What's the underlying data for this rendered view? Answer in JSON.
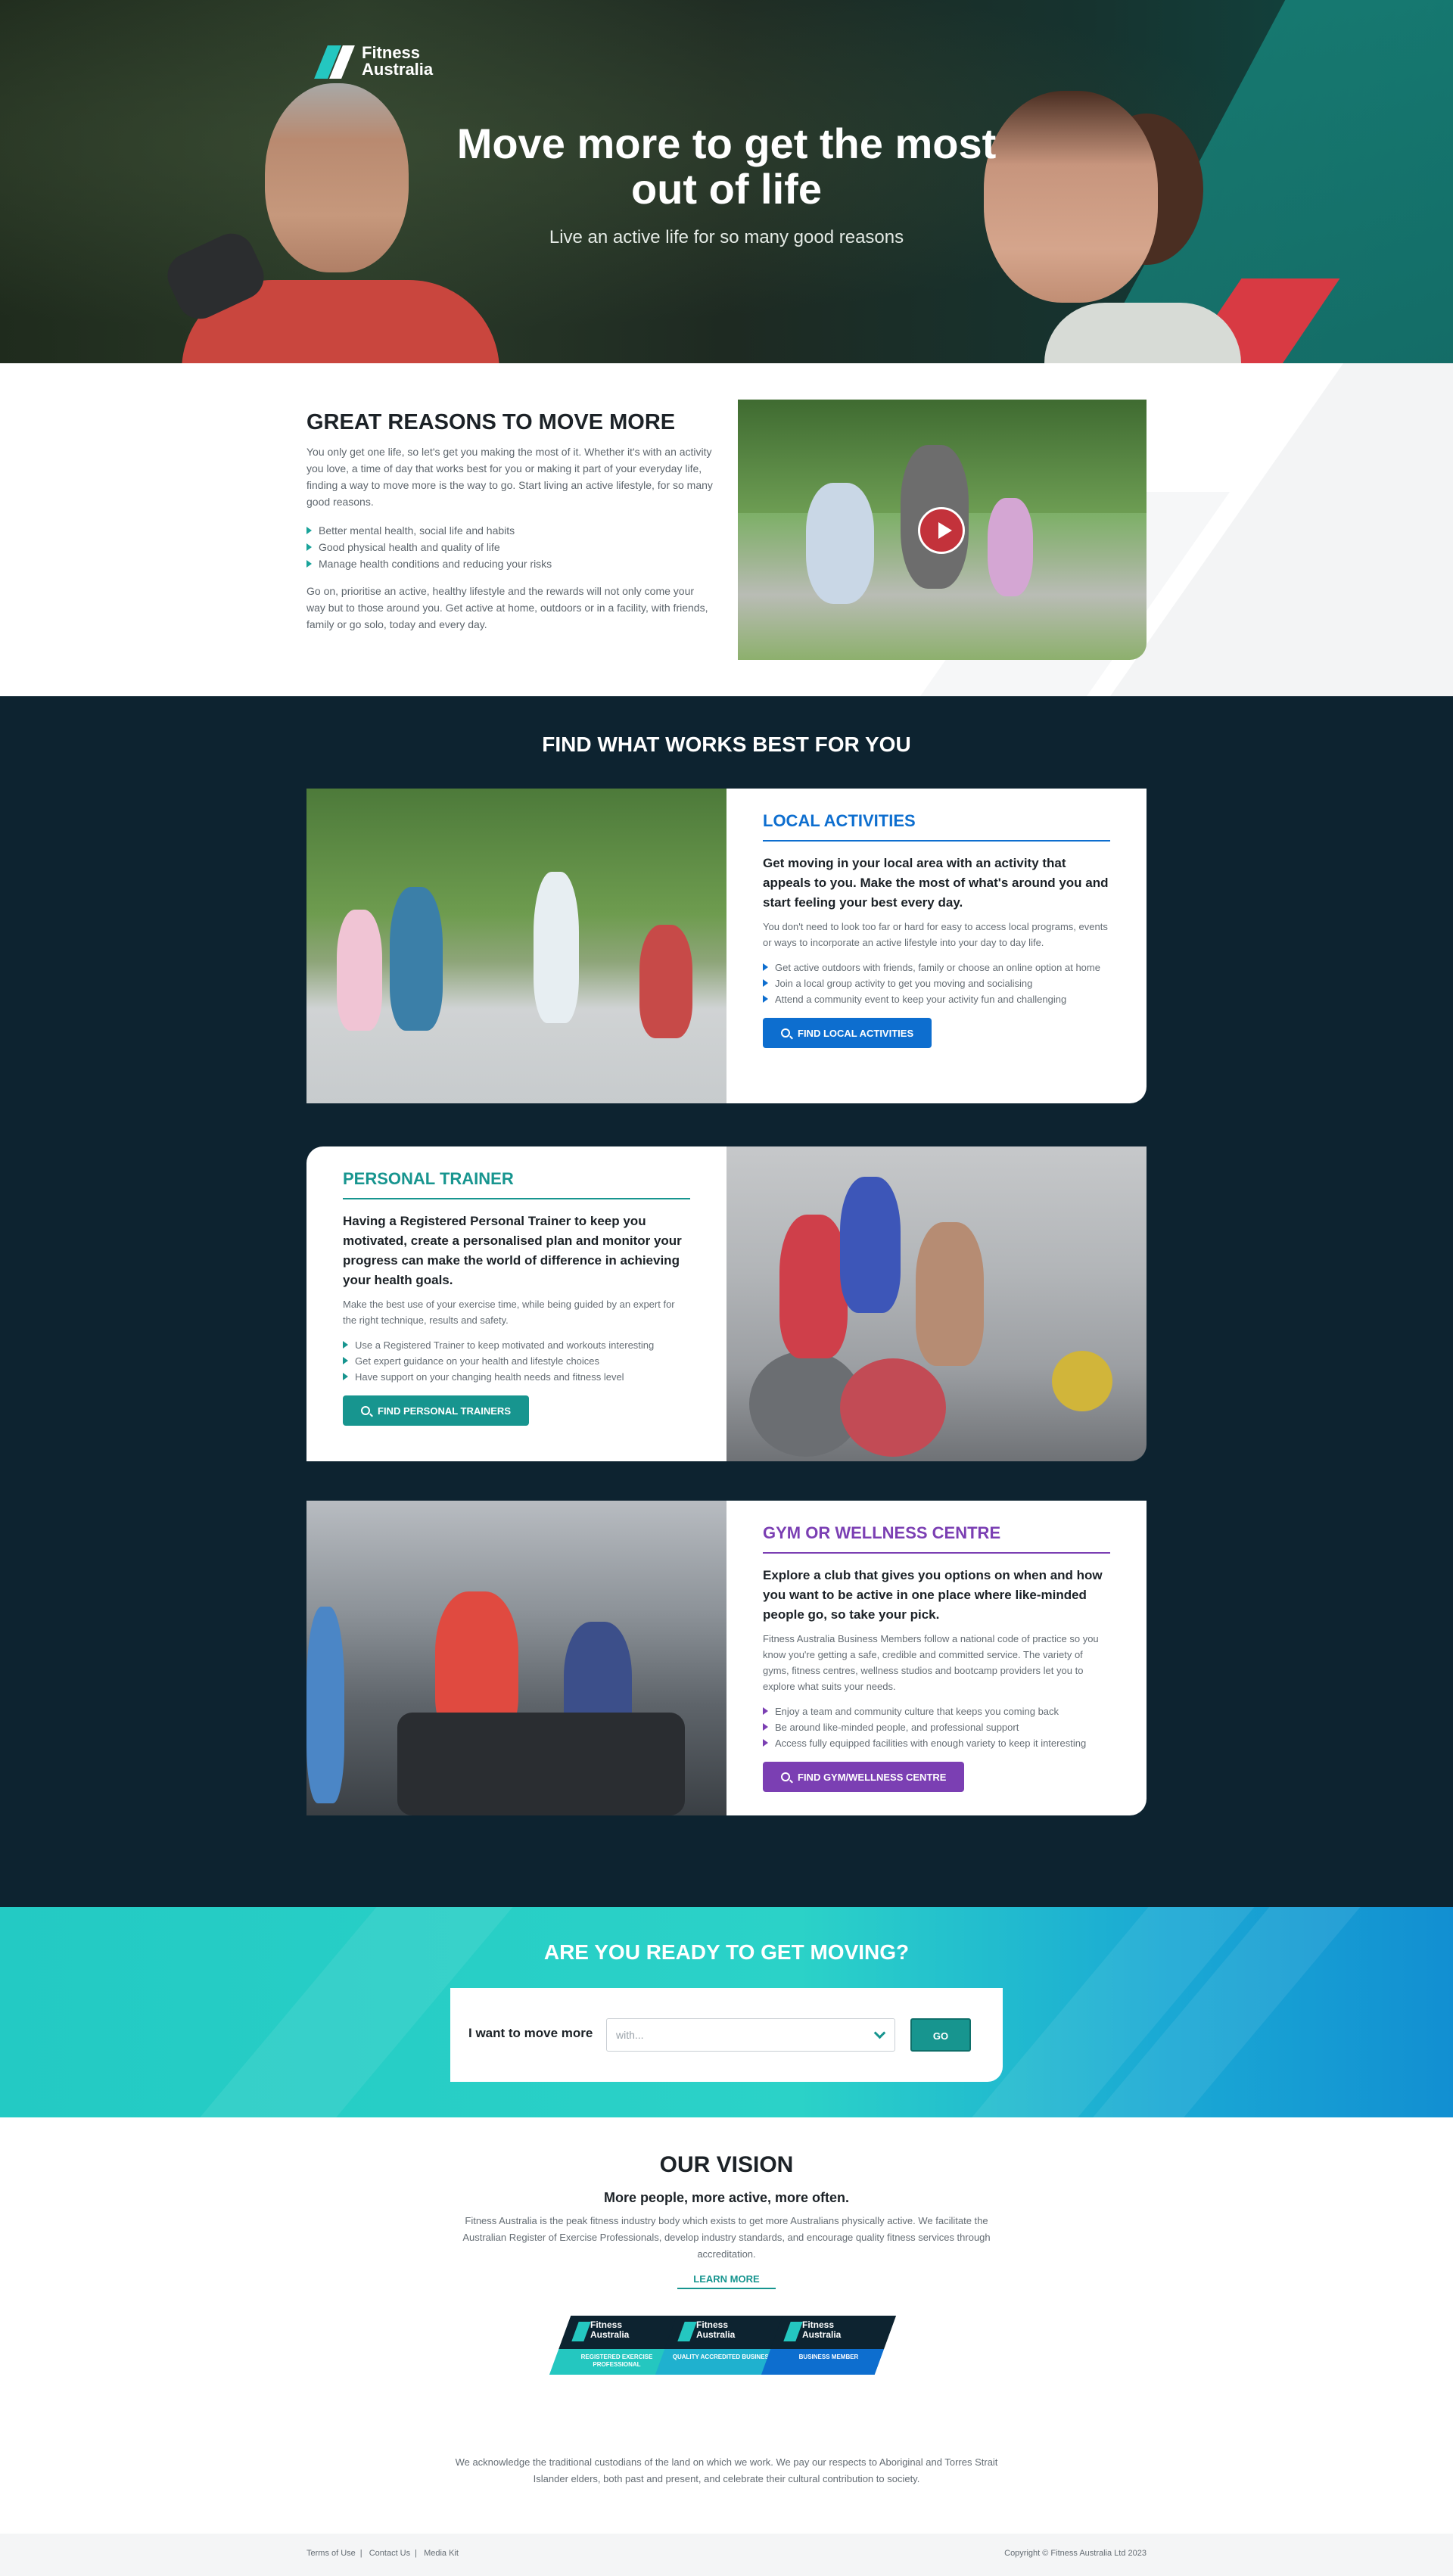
{
  "hero": {
    "logo_line1": "Fitness",
    "logo_line2": "Australia",
    "title": "Move more to get the most out of life",
    "subtitle": "Live an active life for so many good reasons"
  },
  "reasons": {
    "heading": "GREAT REASONS TO MOVE MORE",
    "intro": "You only get one life, so let's get you making the most of it. Whether it's with an activity you love, a time of day that works best for you or making it part of your everyday life, finding a way to move more is the way to go. Start living an active lifestyle, for so many good reasons.",
    "bullets": [
      "Better mental health, social life and habits",
      "Good physical health and quality of life",
      "Manage health conditions and reducing your risks"
    ],
    "closing": "Go on, prioritise an active, healthy lifestyle and the rewards will not only come your way but to those around you. Get active at home, outdoors or in a facility, with friends, family or go solo, today and every day."
  },
  "find": {
    "heading": "FIND WHAT WORKS BEST FOR YOU",
    "cards": [
      {
        "title": "LOCAL ACTIVITIES",
        "lead": "Get moving in your local area with an activity that appeals to you. Make the most of what's around you and start feeling your best every day.",
        "desc": "You don't need to look too far or hard for easy to access local programs, events or ways to incorporate an active lifestyle into your day to day life.",
        "bullets": [
          "Get active outdoors with friends, family or choose an online option at home",
          "Join a local group activity to get you moving and socialising",
          "Attend a community event to keep your activity fun and challenging"
        ],
        "button": "FIND LOCAL ACTIVITIES"
      },
      {
        "title": "PERSONAL TRAINER",
        "lead": "Having a Registered Personal Trainer to keep you motivated, create a personalised plan and monitor your progress can make the world of difference in achieving your health goals.",
        "desc": "Make the best use of your exercise time, while being guided by an expert for the right technique, results and safety.",
        "bullets": [
          "Use a Registered Trainer to keep motivated and workouts interesting",
          "Get expert guidance on your health and lifestyle choices",
          "Have support on your changing health needs and fitness level"
        ],
        "button": "FIND PERSONAL TRAINERS"
      },
      {
        "title": "GYM OR WELLNESS CENTRE",
        "lead": "Explore a club that gives you options on when and how you want to be active in one place where like-minded people go, so take your pick.",
        "desc": "Fitness Australia Business Members follow a national code of practice so you know you're getting a safe, credible and committed service. The variety of gyms, fitness centres, wellness studios and bootcamp providers let you to explore what suits your needs.",
        "bullets": [
          "Enjoy a team and community culture that keeps you coming back",
          "Be around like-minded people, and professional support",
          "Access fully equipped facilities with enough variety to keep it interesting"
        ],
        "button": "FIND GYM/WELLNESS CENTRE"
      }
    ]
  },
  "ready": {
    "heading": "ARE YOU READY TO GET MOVING?",
    "label": "I want to move more",
    "select_placeholder": "with...",
    "go": "GO"
  },
  "vision": {
    "heading": "OUR VISION",
    "tagline": "More people, more active, more often.",
    "desc": "Fitness Australia is the peak fitness industry body which exists to get more Australians physically active. We facilitate the Australian Register of Exercise Professionals, develop industry standards, and encourage quality fitness services through accreditation.",
    "learn_more": "LEARN MORE",
    "badges": [
      {
        "brand1": "Fitness",
        "brand2": "Australia",
        "label": "REGISTERED EXERCISE PROFESSIONAL",
        "color": "#24c7c0"
      },
      {
        "brand1": "Fitness",
        "brand2": "Australia",
        "label": "QUALITY ACCREDITED BUSINESS",
        "color": "#1fb1cf"
      },
      {
        "brand1": "Fitness",
        "brand2": "Australia",
        "label": "BUSINESS MEMBER",
        "color": "#0d6ecf"
      }
    ],
    "acknowledgement": "We acknowledge the traditional custodians of the land on which we work. We pay our respects to Aboriginal and Torres Strait Islander elders, both past and present, and celebrate their cultural contribution to society."
  },
  "footer": {
    "links": [
      "Terms of Use",
      "Contact Us",
      "Media Kit"
    ],
    "copyright": "Copyright © Fitness Australia Ltd 2023"
  }
}
